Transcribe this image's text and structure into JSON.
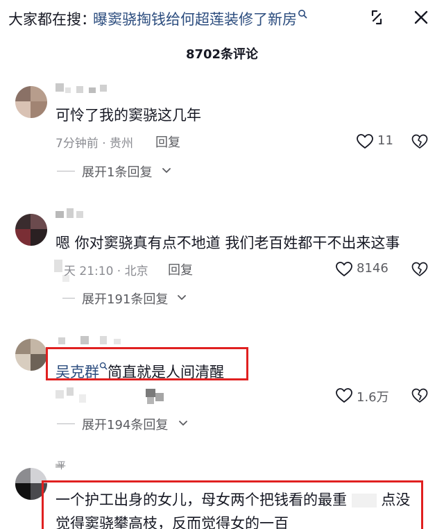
{
  "header": {
    "search_prefix": "大家都在搜：",
    "search_query": "曝窦骁掏钱给何超莲装修了新房",
    "search_icon": "search-icon",
    "expand_icon": "expand-icon",
    "close_icon": "close-icon"
  },
  "comments_header": {
    "count_label": "8702条评论"
  },
  "comments": [
    {
      "text": "可怜了我的窦骁这几年",
      "meta": "7分钟前 · 贵州",
      "reply_label": "回复",
      "likes": "11",
      "expand_label": "展开1条回复"
    },
    {
      "text": "嗯 你对窦骁真有点不地道 我们老百姓都干不出来这事",
      "meta": "昨天 21:10 · 北京",
      "meta_visible": "天 21:10 · 北京",
      "reply_label": "回复",
      "likes": "8146",
      "expand_label": "展开191条回复"
    },
    {
      "mention": "吴克群",
      "text": "简直就是人间清醒",
      "likes": "1.6万",
      "expand_label": "展开194条回复"
    },
    {
      "author": "平",
      "line1_a": "一个护工出身的女儿，母女两个把钱看的最重",
      "line1_b": "点没",
      "line2": "觉得窦骁攀高枝，反而觉得女的一百"
    }
  ],
  "colors": {
    "link_blue": "#2b4c7e",
    "highlight_red": "#e02020",
    "meta_gray": "#8a8b91",
    "text_dark": "#161823"
  }
}
